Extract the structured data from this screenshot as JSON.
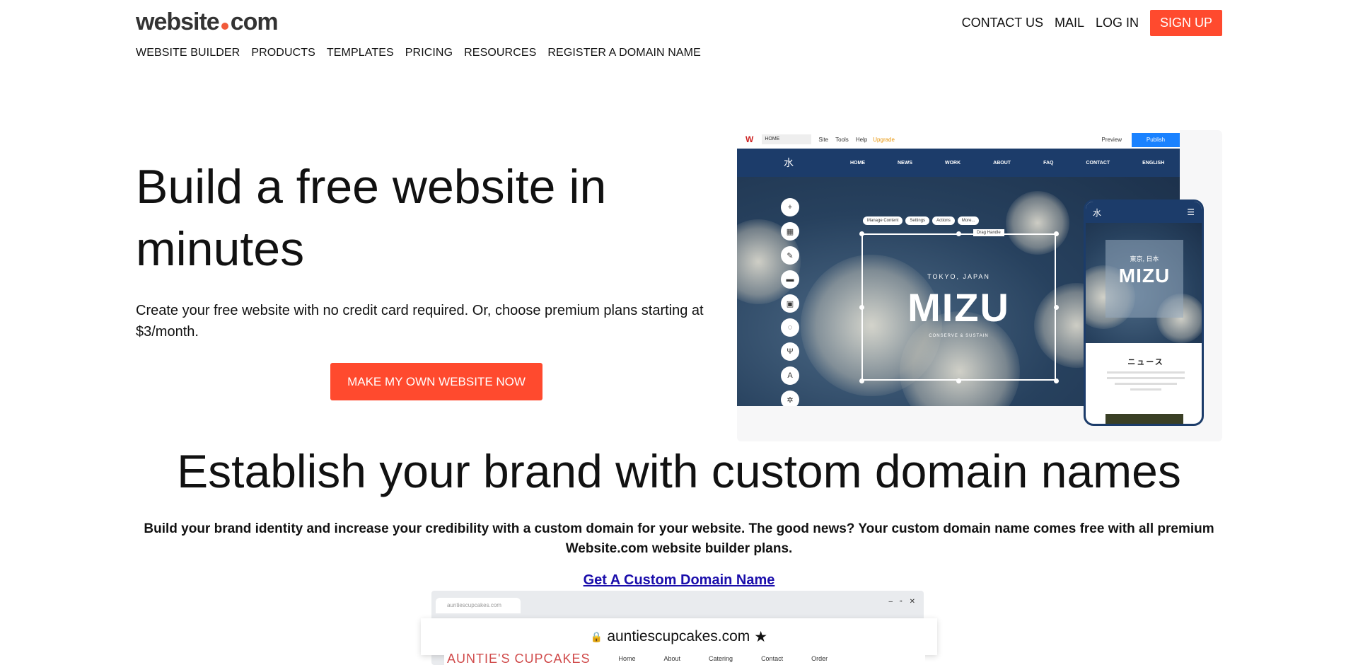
{
  "header": {
    "logo_left": "website",
    "logo_right": "com",
    "top_links": [
      "CONTACT US",
      "MAIL",
      "LOG IN"
    ],
    "signup": "SIGN UP",
    "nav": [
      "WEBSITE BUILDER",
      "PRODUCTS",
      "TEMPLATES",
      "PRICING",
      "RESOURCES",
      "REGISTER A DOMAIN NAME"
    ]
  },
  "hero": {
    "title": "Build a free website in minutes",
    "subtitle": "Create your free website with no credit card required. Or, choose premium plans starting at $3/month.",
    "cta": "MAKE MY OWN WEBSITE NOW"
  },
  "mockup": {
    "toolbar": {
      "page": "HOME",
      "menu": [
        "Site",
        "Tools",
        "Help"
      ],
      "upgrade": "Upgrade",
      "preview": "Preview",
      "publish": "Publish"
    },
    "site_nav": [
      "HOME",
      "NEWS",
      "WORK",
      "ABOUT",
      "FAQ",
      "CONTACT",
      "ENGLISH"
    ],
    "pills": [
      "Manage Content",
      "Settings",
      "Actions",
      "More..."
    ],
    "drag_handle": "Drag Handle",
    "location": "TOKYO, JAPAN",
    "brand": "MIZU",
    "tagline": "CONSERVE & SUSTAIN",
    "phone_location": "東京, 日本",
    "phone_news": "ニュース",
    "kanji": "水"
  },
  "section": {
    "title": "Establish your brand with custom domain names",
    "subtitle": "Build your brand identity and increase your credibility with a custom domain for your website. The good news? Your custom domain name comes free with all premium Website.com website builder plans.",
    "link": "Get A Custom Domain Name"
  },
  "browser": {
    "tab": "auntiescupcakes.com",
    "url": "auntiescupcakes.com",
    "site_logo": "AUNTIE'S CUPCAKES",
    "site_nav": [
      "Home",
      "About",
      "Catering",
      "Contact",
      "Order"
    ]
  },
  "colors": {
    "accent": "#ff4a2e",
    "link": "#1a0dab",
    "mizu_nav": "#1c3c6a"
  }
}
